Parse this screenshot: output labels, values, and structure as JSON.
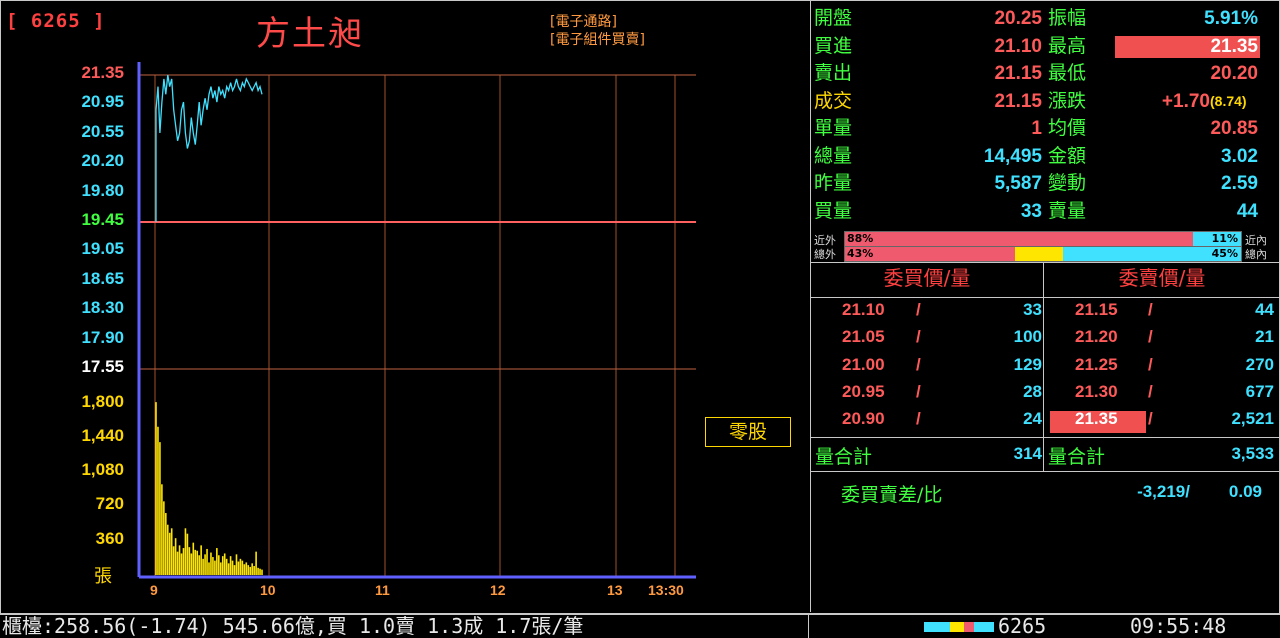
{
  "header": {
    "code": "[ 6265 ]",
    "name": "方土昶",
    "category1": "[電子通路]",
    "category2": "[電子組件買賣]"
  },
  "chart": {
    "price_labels": [
      {
        "text": "21.35",
        "color": "#ff5a5a"
      },
      {
        "text": "20.95",
        "color": "#40e0ff"
      },
      {
        "text": "20.55",
        "color": "#40e0ff"
      },
      {
        "text": "20.20",
        "color": "#40e0ff"
      },
      {
        "text": "19.80",
        "color": "#40e0ff"
      },
      {
        "text": "19.45",
        "color": "#40ff40"
      },
      {
        "text": "19.05",
        "color": "#40e0ff"
      },
      {
        "text": "18.65",
        "color": "#40e0ff"
      },
      {
        "text": "18.30",
        "color": "#40e0ff"
      },
      {
        "text": "17.90",
        "color": "#40e0ff"
      },
      {
        "text": "17.55",
        "color": "#ffffff"
      }
    ],
    "volume_labels": [
      "1,800",
      "1,440",
      "1,080",
      "720",
      "360"
    ],
    "volume_unit": "張",
    "x_labels": [
      "9",
      "10",
      "11",
      "12",
      "13",
      "13:30"
    ],
    "odd_lot_button": "零股"
  },
  "chart_data": {
    "type": "line",
    "reference_price": 19.45,
    "ylim": [
      17.55,
      21.35
    ],
    "price_series": [
      20.9,
      21.2,
      20.6,
      21.0,
      21.3,
      21.1,
      21.35,
      21.2,
      21.3,
      20.9,
      20.7,
      20.5,
      20.6,
      20.9,
      21.0,
      20.6,
      20.4,
      20.5,
      20.8,
      20.6,
      20.45,
      20.7,
      21.0,
      20.7,
      20.9,
      21.05,
      20.9,
      21.1,
      21.2,
      21.05,
      21.15,
      21.0,
      21.2,
      21.1,
      21.15,
      21.05,
      21.2,
      21.15,
      21.25,
      21.15,
      21.2,
      21.3,
      21.2,
      21.15,
      21.25,
      21.2,
      21.3,
      21.25,
      21.2,
      21.15,
      21.2,
      21.25,
      21.15,
      21.2,
      21.1
    ],
    "volume_ylim": [
      0,
      2160
    ],
    "volume_series": [
      1925,
      1650,
      1480,
      1010,
      820,
      690,
      560,
      470,
      520,
      320,
      410,
      260,
      330,
      240,
      300,
      520,
      460,
      310,
      240,
      360,
      280,
      270,
      220,
      330,
      180,
      230,
      290,
      140,
      250,
      200,
      160,
      300,
      220,
      140,
      210,
      240,
      180,
      130,
      210,
      160,
      110,
      230,
      150,
      180,
      160,
      120,
      140,
      110,
      90,
      130,
      100,
      260,
      80,
      70,
      60
    ]
  },
  "quote": {
    "left": [
      {
        "label": "開盤",
        "value": "20.25",
        "vcolor": "#ff5a5a"
      },
      {
        "label": "買進",
        "value": "21.10",
        "vcolor": "#ff5a5a"
      },
      {
        "label": "賣出",
        "value": "21.15",
        "vcolor": "#ff5a5a"
      },
      {
        "label": "成交",
        "value": "21.15",
        "vcolor": "#ff5a5a",
        "lcolor": "#ffd700"
      },
      {
        "label": "單量",
        "value": "1",
        "vcolor": "#ff5a5a"
      },
      {
        "label": "總量",
        "value": "14,495",
        "vcolor": "#40e0ff"
      },
      {
        "label": "昨量",
        "value": "5,587",
        "vcolor": "#40e0ff"
      },
      {
        "label": "買量",
        "value": "33",
        "vcolor": "#40e0ff"
      }
    ],
    "right": [
      {
        "label": "振幅",
        "value": "5.91%",
        "vcolor": "#40e0ff"
      },
      {
        "label": "最高",
        "value": "21.35",
        "vcolor": "#ffffff",
        "bg": "#f05050"
      },
      {
        "label": "最低",
        "value": "20.20",
        "vcolor": "#ff5a5a"
      },
      {
        "label": "漲跌",
        "value": "+1.70",
        "vcolor": "#ff5a5a",
        "extra": "(8.74)"
      },
      {
        "label": "均價",
        "value": "20.85",
        "vcolor": "#ff5a5a"
      },
      {
        "label": "金額",
        "value": "3.02",
        "vcolor": "#40e0ff"
      },
      {
        "label": "變動",
        "value": "2.59",
        "vcolor": "#40e0ff"
      },
      {
        "label": "賣量",
        "value": "44",
        "vcolor": "#40e0ff"
      }
    ]
  },
  "ratio": {
    "near_left": "近外",
    "near_right": "近內",
    "total_left": "總外",
    "total_right": "總內",
    "near_out": "88%",
    "near_in": "11%",
    "total_out": "43%",
    "total_in": "45%",
    "near_out_frac": 0.88,
    "near_in_frac": 0.11,
    "total_out_frac": 0.43,
    "total_mid_frac": 0.12,
    "total_in_frac": 0.45
  },
  "orderbook": {
    "bid_title": "委買價/量",
    "ask_title": "委賣價/量",
    "rows": [
      {
        "bid": "21.10",
        "bid_qty": "33",
        "ask": "21.15",
        "ask_qty": "44"
      },
      {
        "bid": "21.05",
        "bid_qty": "100",
        "ask": "21.20",
        "ask_qty": "21"
      },
      {
        "bid": "21.00",
        "bid_qty": "129",
        "ask": "21.25",
        "ask_qty": "270"
      },
      {
        "bid": "20.95",
        "bid_qty": "28",
        "ask": "21.30",
        "ask_qty": "677"
      },
      {
        "bid": "20.90",
        "bid_qty": "24",
        "ask": "21.35",
        "ask_qty": "2,521"
      }
    ],
    "slash": "/",
    "bid_total_label": "量合計",
    "bid_total": "314",
    "ask_total_label": "量合計",
    "ask_total": "3,533",
    "diff_label": "委買賣差/比",
    "diff_value": "-3,219/",
    "diff_ratio": "0.09"
  },
  "footer": {
    "ticker": "櫃檯:258.56(-1.74) 545.66億,買 1.0賣 1.3成 1.7張/筆",
    "code": "6265",
    "time": "09:55:48"
  }
}
